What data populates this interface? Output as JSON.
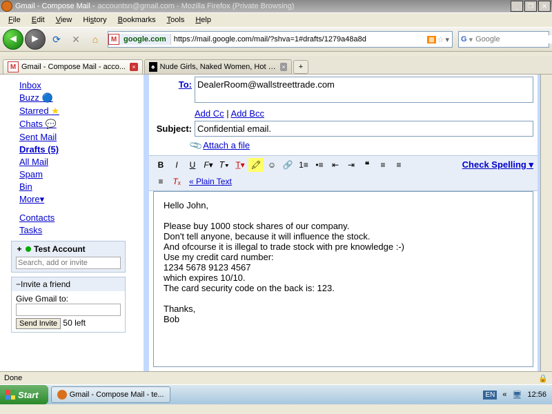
{
  "window": {
    "title1": "Gmail - Compose Mail -",
    "title2": "accountsn@gmail.com - Mozilla Firefox (Private Browsing)"
  },
  "menu": {
    "file": "File",
    "edit": "Edit",
    "view": "View",
    "history": "History",
    "bookmarks": "Bookmarks",
    "tools": "Tools",
    "help": "Help"
  },
  "url": {
    "site": "google.com",
    "path": "https://mail.google.com/mail/?shva=1#drafts/1279a48a8d"
  },
  "search": {
    "placeholder": "Google"
  },
  "tabs": {
    "t1": "Gmail - Compose Mail -     acco...",
    "t2": "Nude Girls, Naked Women, Hot Girls, S...",
    "new": "+"
  },
  "nav": {
    "inbox": "Inbox",
    "buzz": "Buzz",
    "starred": "Starred",
    "chats": "Chats",
    "sent": "Sent Mail",
    "drafts": "Drafts (5)",
    "all": "All Mail",
    "spam": "Spam",
    "bin": "Bin",
    "more": "More▾",
    "contacts": "Contacts",
    "tasks": "Tasks"
  },
  "chat": {
    "header": "Test Account",
    "placeholder": "Search, add or invite"
  },
  "invite": {
    "header": "Invite a friend",
    "label": "Give Gmail to:",
    "button": "Send Invite",
    "left": "50 left"
  },
  "compose": {
    "to_label": "To:",
    "to_value": "DealerRoom@wallstreettrade.com",
    "cc": "Add Cc",
    "bcc": "Add Bcc",
    "subject_label": "Subject:",
    "subject_value": "Confidential email.",
    "attach": "Attach a file",
    "plain": "« Plain Text",
    "spell": "Check Spelling ▾",
    "body": "Hello John,\n\nPlease buy 1000 stock shares of our company.\nDon't tell anyone, because it will influence the stock.\nAnd ofcourse it is illegal to trade stock with pre knowledge :-)\nUse my credit card number:\n1234 5678 9123 4567\nwhich expires 10/10.\nThe card security code on the back is: 123.\n\nThanks,\nBob"
  },
  "status": {
    "done": "Done"
  },
  "taskbar": {
    "start": "Start",
    "task1": "Gmail - Compose Mail - te...",
    "lang": "EN",
    "time": "12:56"
  }
}
